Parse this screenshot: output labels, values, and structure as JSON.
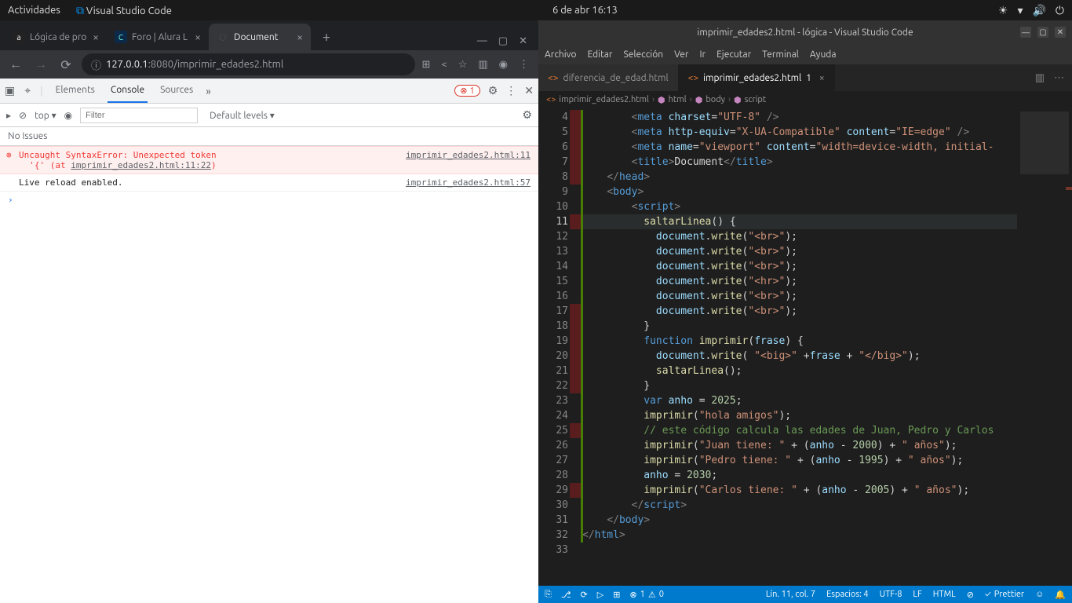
{
  "gnome": {
    "activities": "Actividades",
    "app": "Visual Studio Code",
    "datetime": "6 de abr  16:13"
  },
  "chrome": {
    "tabs": [
      {
        "label": "Lógica de pro",
        "fav": "a",
        "favbg": "#222"
      },
      {
        "label": "Foro | Alura L",
        "fav": "C",
        "favbg": "#0b2a4a"
      },
      {
        "label": "Document",
        "fav": "◌",
        "favbg": "transparent"
      }
    ],
    "url_host": "127.0.0.1",
    "url_port": ":8080",
    "url_path": "/imprimir_edades2.html",
    "devtools": {
      "tabs": {
        "elements": "Elements",
        "console": "Console",
        "sources": "Sources"
      },
      "error_count": "1",
      "top": "top",
      "filter_placeholder": "Filter",
      "levels": "Default levels",
      "issues": "No Issues",
      "error_msg": "Uncaught SyntaxError: Unexpected token",
      "error_loc": "imprimir_edades2.html:11",
      "error_detail_pre": "'{' (at ",
      "error_detail_link": "imprimir_edades2.html:11:22",
      "error_detail_post": ")",
      "reload_msg": "Live reload enabled.",
      "reload_src": "imprimir_edades2.html:57"
    }
  },
  "vscode": {
    "title": "imprimir_edades2.html - lógica - Visual Studio Code",
    "menu": [
      "Archivo",
      "Editar",
      "Selección",
      "Ver",
      "Ir",
      "Ejecutar",
      "Terminal",
      "Ayuda"
    ],
    "tabs": [
      {
        "label": "diferencia_de_edad.html"
      },
      {
        "label": "imprimir_edades2.html",
        "modified": "1"
      }
    ],
    "breadcrumb": [
      "imprimir_edades2.html",
      "html",
      "body",
      "script"
    ],
    "status": {
      "errors": "1",
      "warnings": "0",
      "pos": "Lín. 11, col. 7",
      "spaces": "Espacios: 4",
      "enc": "UTF-8",
      "eol": "LF",
      "lang": "HTML",
      "prettier": "Prettier"
    },
    "line_start": 4,
    "line_count": 30
  }
}
